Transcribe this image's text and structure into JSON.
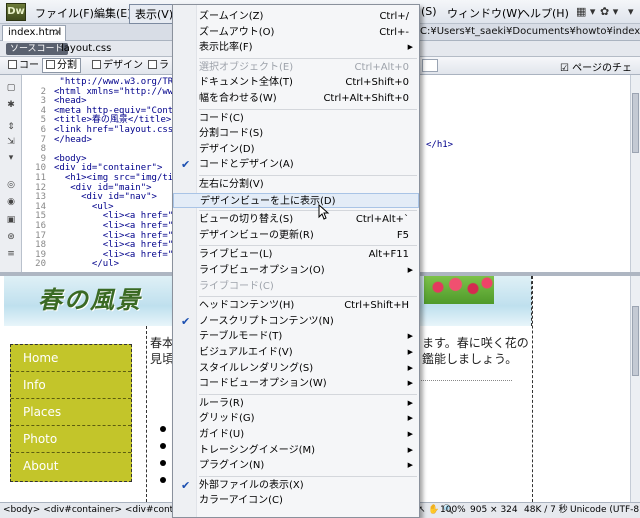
{
  "app": {
    "logo": "Dw"
  },
  "menubar": {
    "items": [
      "ファイル(F)",
      "編集(E)",
      "表示(V)"
    ],
    "items_right": [
      "(S)",
      "ウィンドウ(W)",
      "ヘルプ(H)"
    ],
    "tools": [
      "▦ ▾",
      "✿ ▾",
      "▾"
    ]
  },
  "doctabs": {
    "tab_label": "index.html",
    "tab_close": "×",
    "path": "C:¥Users¥t_saeki¥Documents¥howto¥index.html"
  },
  "related_files": {
    "source_code": "ソースコード",
    "file": "layout.css"
  },
  "doc_toolbar": {
    "code": "コード",
    "split": "分割",
    "design": "デザイン",
    "live": "ラ",
    "right": "ページのチェ"
  },
  "code_view": {
    "lines": [
      {
        "n": "",
        "t": " \"http://www.w3.org/TR/xht"
      },
      {
        "n": "2",
        "t": "<html xmlns=\"http://www.w"
      },
      {
        "n": "3",
        "t": "<head>"
      },
      {
        "n": "4",
        "t": "<meta http-equiv=\"Content"
      },
      {
        "n": "5",
        "t": "<title>春の風景</title>"
      },
      {
        "n": "6",
        "t": "<link href=\"layout.css\" r"
      },
      {
        "n": "7",
        "t": "</head>"
      },
      {
        "n": "8",
        "t": ""
      },
      {
        "n": "9",
        "t": "<body>"
      },
      {
        "n": "10",
        "t": "<div id=\"container\">"
      },
      {
        "n": "11",
        "t": "  <h1><img src=\"img/title"
      },
      {
        "n": "12",
        "t": "   <div id=\"main\">"
      },
      {
        "n": "13",
        "t": "     <div id=\"nav\">"
      },
      {
        "n": "14",
        "t": "       <ul>"
      },
      {
        "n": "15",
        "t": "         <li><a href=\"#\">H"
      },
      {
        "n": "16",
        "t": "         <li><a href=\"#\">I"
      },
      {
        "n": "17",
        "t": "         <li><a href=\"#\">P"
      },
      {
        "n": "18",
        "t": "         <li><a href=\"#\">P"
      },
      {
        "n": "19",
        "t": "         <li><a href=\"#\">A"
      },
      {
        "n": "20",
        "t": "       </ul>"
      }
    ],
    "h1_close": "</h1>"
  },
  "design_view": {
    "banner_title": "春の風景",
    "nav": [
      "Home",
      "Info",
      "Places",
      "Photo",
      "About"
    ],
    "text_left_1": "春本",
    "text_left_2": "見頃",
    "text_right_1": "ます。春に咲く花の",
    "text_right_2": "鑑能しましょう。"
  },
  "status_bar": {
    "tag_path": "<body> <div#container> <div#contents> <ul> <li>",
    "zoom": "100%",
    "size": "905 × 324",
    "filesize": "48K / 7 秒",
    "encoding": "Unicode (UTF-8)"
  },
  "view_menu": {
    "items": [
      {
        "label": "ズームイン(Z)",
        "shortcut": "Ctrl+/"
      },
      {
        "label": "ズームアウト(O)",
        "shortcut": "Ctrl+-"
      },
      {
        "label": "表示比率(F)",
        "submenu": true
      },
      {
        "sep": true
      },
      {
        "label": "選択オブジェクト(E)",
        "shortcut": "Ctrl+Alt+0",
        "disabled": true
      },
      {
        "label": "ドキュメント全体(T)",
        "shortcut": "Ctrl+Shift+0"
      },
      {
        "label": "幅を合わせる(W)",
        "shortcut": "Ctrl+Alt+Shift+0"
      },
      {
        "sep": true
      },
      {
        "label": "コード(C)"
      },
      {
        "label": "分割コード(S)"
      },
      {
        "label": "デザイン(D)"
      },
      {
        "label": "コードとデザイン(A)",
        "checked": true
      },
      {
        "sep": true
      },
      {
        "label": "左右に分割(V)"
      },
      {
        "label": "デザインビューを上に表示(D)",
        "hover": true
      },
      {
        "sep": true
      },
      {
        "label": "ビューの切り替え(S)",
        "shortcut": "Ctrl+Alt+`"
      },
      {
        "label": "デザインビューの更新(R)",
        "shortcut": "F5"
      },
      {
        "sep": true
      },
      {
        "label": "ライブビュー(L)",
        "shortcut": "Alt+F11"
      },
      {
        "label": "ライブビューオプション(O)",
        "submenu": true
      },
      {
        "label": "ライブコード(C)",
        "disabled": true
      },
      {
        "sep": true
      },
      {
        "label": "ヘッドコンテンツ(H)",
        "shortcut": "Ctrl+Shift+H"
      },
      {
        "label": "ノースクリプトコンテンツ(N)",
        "checked": true
      },
      {
        "label": "テーブルモード(T)",
        "submenu": true
      },
      {
        "label": "ビジュアルエイド(V)",
        "submenu": true
      },
      {
        "label": "スタイルレンダリング(S)",
        "submenu": true
      },
      {
        "label": "コードビューオプション(W)",
        "submenu": true
      },
      {
        "sep": true
      },
      {
        "label": "ルーラ(R)",
        "submenu": true
      },
      {
        "label": "グリッド(G)",
        "submenu": true
      },
      {
        "label": "ガイド(U)",
        "submenu": true
      },
      {
        "label": "トレーシングイメージ(M)",
        "submenu": true
      },
      {
        "label": "プラグイン(N)",
        "submenu": true
      },
      {
        "sep": true
      },
      {
        "label": "外部ファイルの表示(X)",
        "checked": true
      },
      {
        "label": "カラーアイコン(C)"
      }
    ]
  }
}
